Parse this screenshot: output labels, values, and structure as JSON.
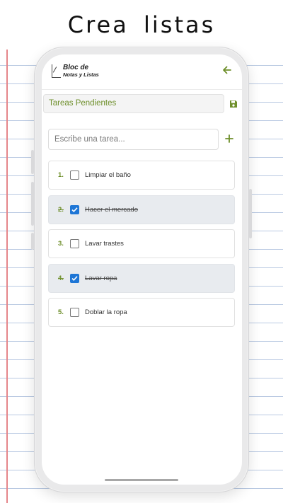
{
  "headline": "Crea listas",
  "app": {
    "logo_line1": "Bloc de",
    "logo_line2": "Notas y Listas"
  },
  "list": {
    "name": "Tareas Pendientes"
  },
  "task_input": {
    "placeholder": "Escribe una tarea..."
  },
  "icons": {
    "back": "arrow-left-icon",
    "save": "floppy-disk-icon",
    "add": "plus-icon",
    "check": "checkmark-icon"
  },
  "colors": {
    "accent": "#6e8f2b",
    "checkbox_checked": "#1e76d6",
    "done_row_bg": "#e8ebef",
    "paper_rule": "#b9c9e2",
    "margin_rule": "#e5868a"
  },
  "tasks": [
    {
      "number": "1.",
      "text": "Limpiar el baño",
      "done": false
    },
    {
      "number": "2.",
      "text": "Hacer el mercado",
      "done": true
    },
    {
      "number": "3.",
      "text": "Lavar trastes",
      "done": false
    },
    {
      "number": "4.",
      "text": "Lavar ropa",
      "done": true
    },
    {
      "number": "5.",
      "text": "Doblar la ropa",
      "done": false
    }
  ]
}
